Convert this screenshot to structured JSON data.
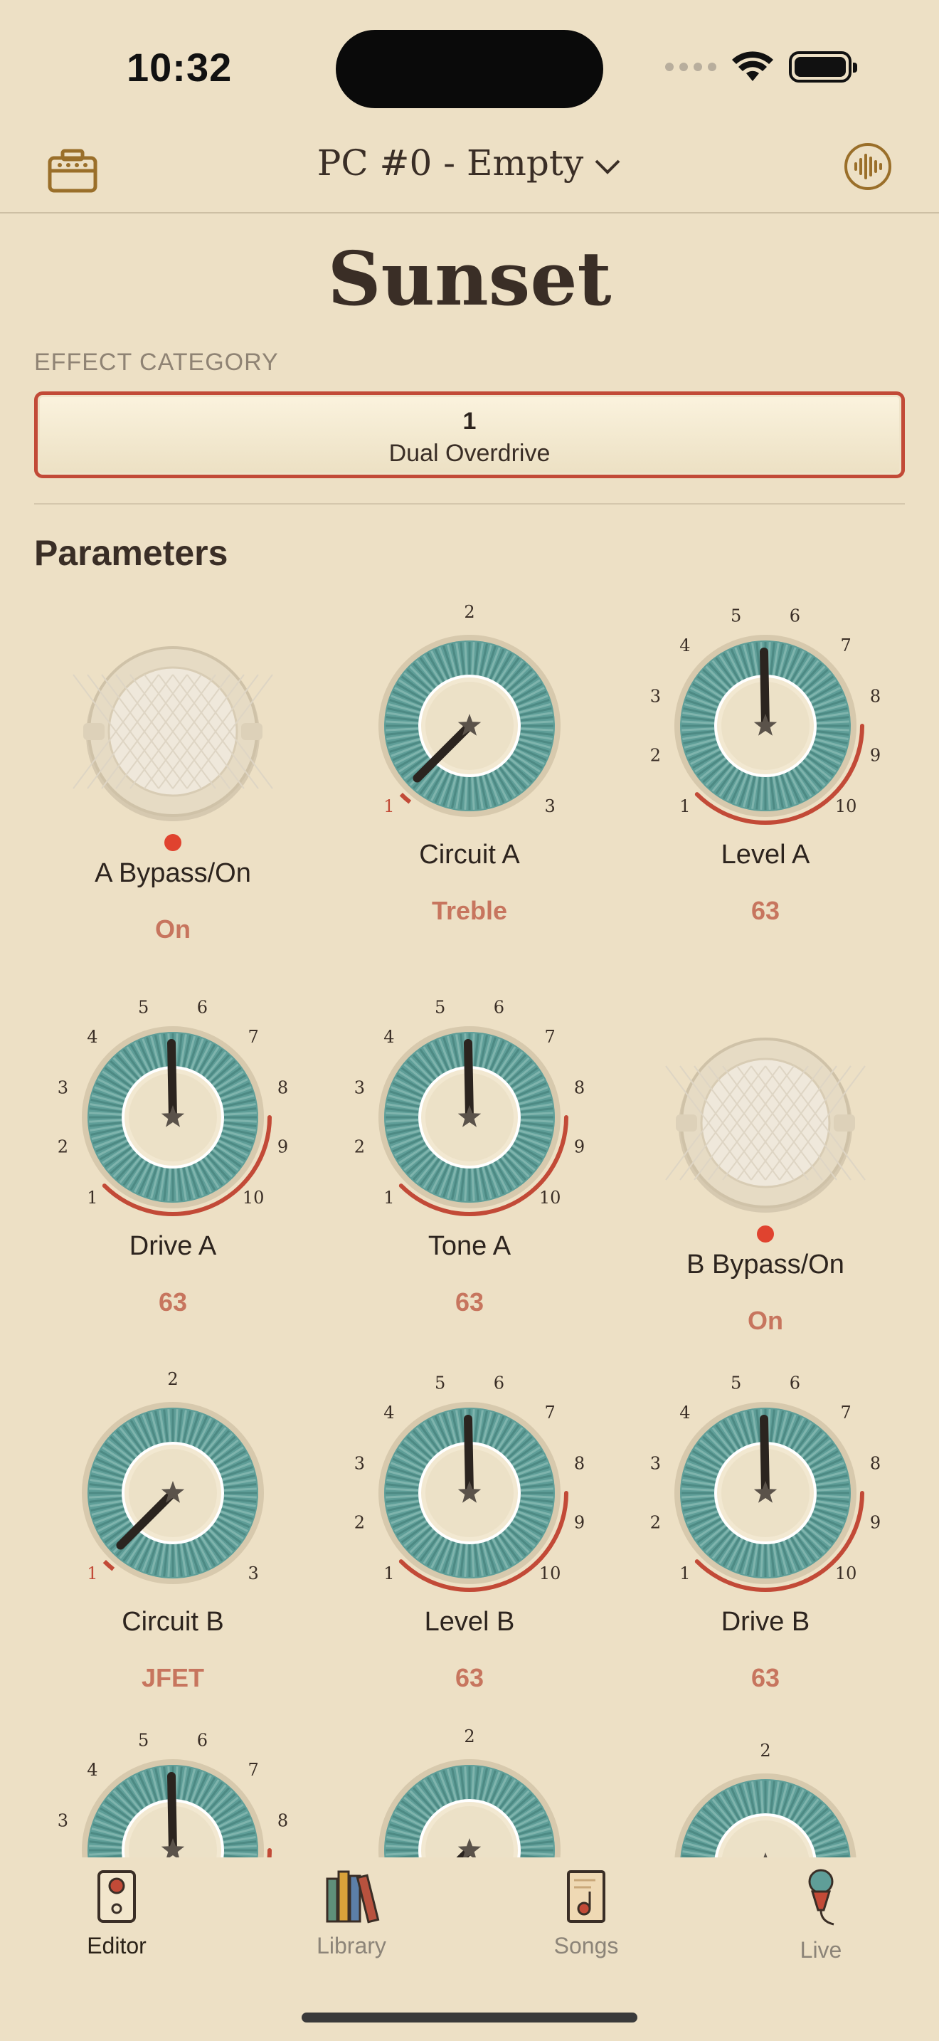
{
  "status": {
    "time": "10:32"
  },
  "nav": {
    "title": "PC #0 - Empty"
  },
  "preset": {
    "name": "Sunset"
  },
  "category": {
    "label": "EFFECT CATEGORY",
    "number": "1",
    "name": "Dual Overdrive"
  },
  "parameters": {
    "title": "Parameters",
    "items": [
      {
        "name": "A Bypass/On",
        "value": "On",
        "kind": "switch"
      },
      {
        "name": "Circuit A",
        "value": "Treble",
        "kind": "selector"
      },
      {
        "name": "Level A",
        "value": "63",
        "kind": "knob"
      },
      {
        "name": "Drive A",
        "value": "63",
        "kind": "knob"
      },
      {
        "name": "Tone A",
        "value": "63",
        "kind": "knob"
      },
      {
        "name": "B Bypass/On",
        "value": "On",
        "kind": "switch"
      },
      {
        "name": "Circuit B",
        "value": "JFET",
        "kind": "selector"
      },
      {
        "name": "Level B",
        "value": "63",
        "kind": "knob"
      },
      {
        "name": "Drive B",
        "value": "63",
        "kind": "knob"
      }
    ]
  },
  "knob_scale": [
    "1",
    "2",
    "3",
    "4",
    "5",
    "6",
    "7",
    "8",
    "9",
    "10"
  ],
  "selector_scale": [
    "1",
    "2",
    "3"
  ],
  "tabs": [
    {
      "label": "Editor",
      "icon": "pedal-icon",
      "active": true
    },
    {
      "label": "Library",
      "icon": "books-icon",
      "active": false
    },
    {
      "label": "Songs",
      "icon": "songbook-icon",
      "active": false
    },
    {
      "label": "Live",
      "icon": "microphone-icon",
      "active": false
    }
  ],
  "colors": {
    "background": "#ede0c5",
    "accent": "#c24a37",
    "value": "#c7755e",
    "teal": "#5f9e98",
    "brown": "#8f6a2e"
  }
}
